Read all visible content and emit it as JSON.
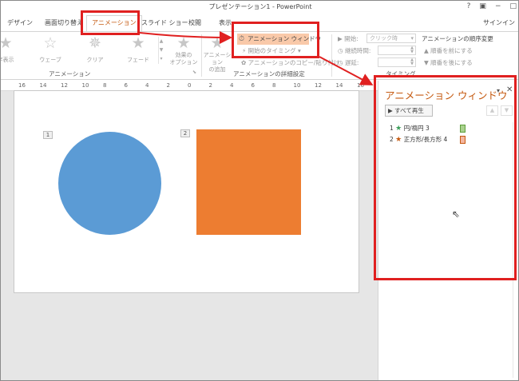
{
  "window": {
    "title": "プレゼンテーション1 - PowerPoint",
    "controls": [
      "?",
      "▣",
      "−",
      "□"
    ]
  },
  "tabs": [
    {
      "label": "デザイン"
    },
    {
      "label": "画面切り替え"
    },
    {
      "label": "アニメーション",
      "active": true
    },
    {
      "label": "スライド ショー"
    },
    {
      "label": "校閲"
    },
    {
      "label": "表示"
    }
  ],
  "signin": "サインイン",
  "ribbon": {
    "effects": [
      {
        "label": "字表示"
      },
      {
        "label": "ウェーブ"
      },
      {
        "label": "クリア"
      },
      {
        "label": "フェード"
      }
    ],
    "effect_options": "効果の\nオプション",
    "add_animation": "アニメーション\nの追加",
    "group_animation": "アニメーション",
    "group_advanced": "アニメーションの詳細設定",
    "group_timing": "タイミング",
    "animation_pane_button": "アニメーション ウィンドウ",
    "trigger": "開始のタイミング",
    "copy_animation": "アニメーションのコピー/貼り付け",
    "start_label": "開始:",
    "start_value": "クリック時",
    "duration_label": "継続時間:",
    "delay_label": "遅延:",
    "reorder_header": "アニメーションの順序変更",
    "move_earlier": "順番を前にする",
    "move_later": "順番を後にする"
  },
  "ruler": [
    "16",
    "14",
    "12",
    "10",
    "8",
    "6",
    "4",
    "2",
    "0",
    "2",
    "4",
    "6",
    "8",
    "10",
    "12",
    "14",
    "16"
  ],
  "slide": {
    "shape_tags": [
      "1",
      "2"
    ],
    "circle_color": "#5b9bd5",
    "rect_color": "#ed7d31"
  },
  "pane": {
    "title": "アニメーション ウィンドウ",
    "play_all": "すべて再生",
    "items": [
      {
        "num": "1",
        "name": "円/楕円 3",
        "star_color": "#3b9e5a",
        "bar_color": "#a9d18e"
      },
      {
        "num": "2",
        "name": "正方形/長方形 4",
        "star_color": "#c55a11",
        "bar_color": "#f4b6a0"
      }
    ]
  },
  "colors": {
    "accent": "#c55a11",
    "highlight": "#e02020"
  }
}
